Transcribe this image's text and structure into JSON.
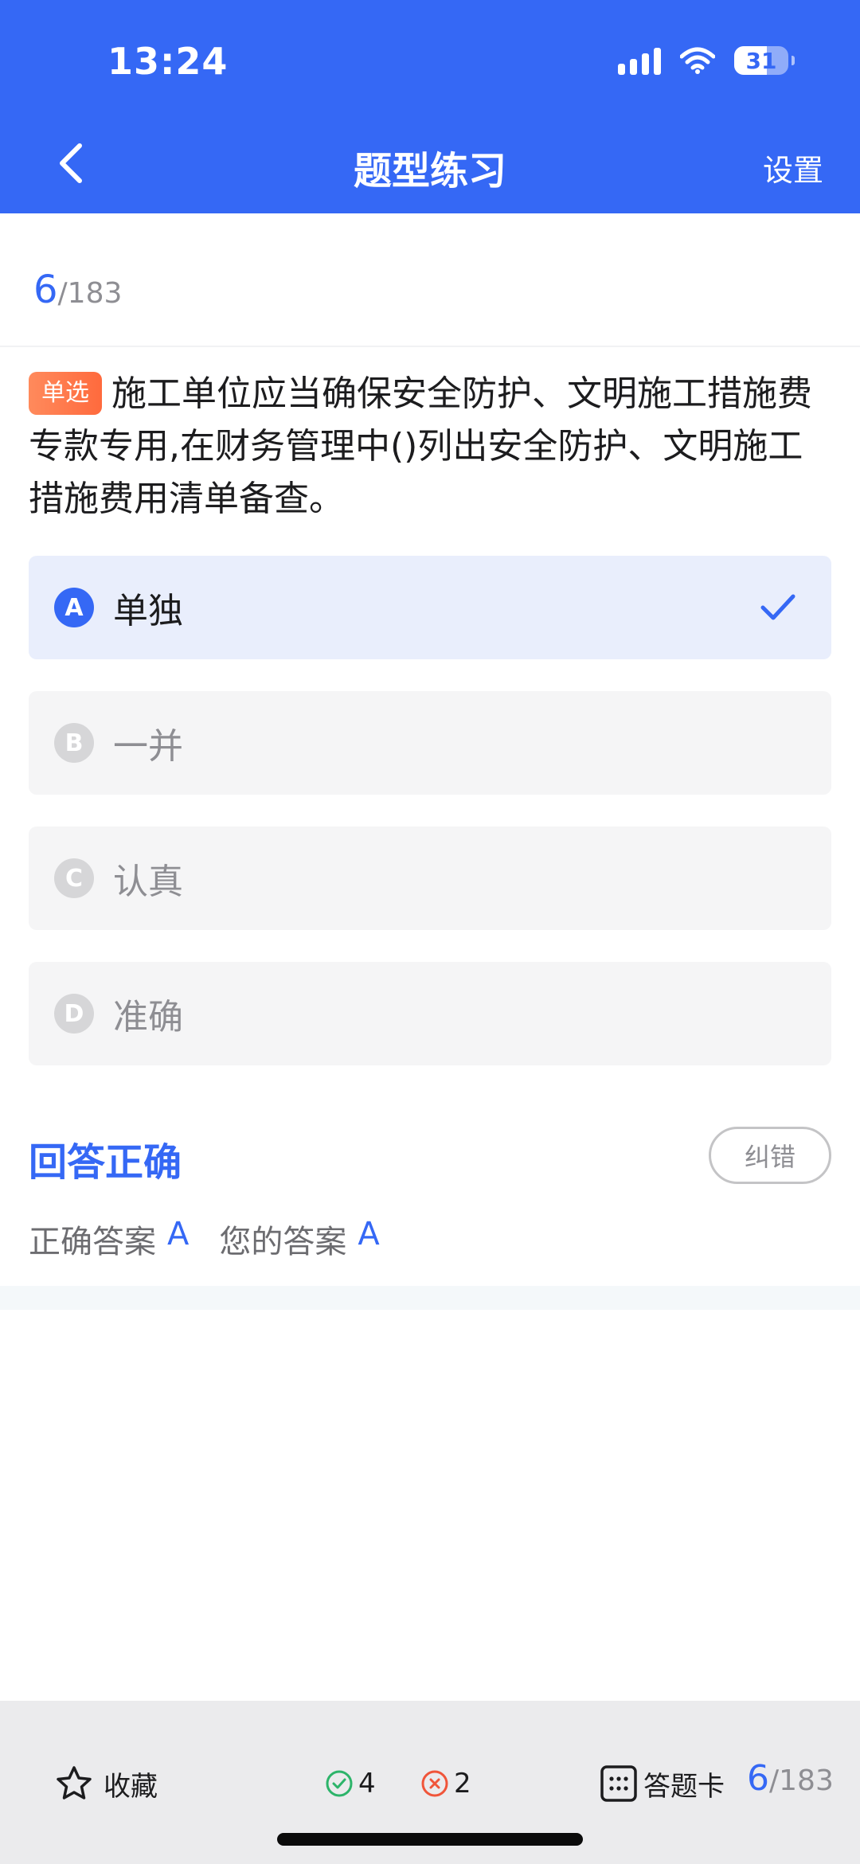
{
  "status_bar": {
    "time": "13:24",
    "battery": "31"
  },
  "nav": {
    "title": "题型练习",
    "settings": "设置"
  },
  "progress": {
    "current": "6",
    "total": "/183"
  },
  "question": {
    "tag": "单选",
    "text": "施工单位应当确保安全防护、文明施工措施费专款专用,在财务管理中()列出安全防护、文明施工措施费用清单备查。"
  },
  "options": [
    {
      "letter": "A",
      "text": "单独",
      "selected": true
    },
    {
      "letter": "B",
      "text": "一并"
    },
    {
      "letter": "C",
      "text": "认真"
    },
    {
      "letter": "D",
      "text": "准确"
    }
  ],
  "result": {
    "title": "回答正确",
    "report_button": "纠错",
    "correct_label": "正确答案",
    "correct_value": "A",
    "yours_label": "您的答案",
    "yours_value": "A"
  },
  "bottom_bar": {
    "favorite": "收藏",
    "correct_count": "4",
    "wrong_count": "2",
    "answer_card": "答题卡",
    "current": "6",
    "total": "/183"
  },
  "colors": {
    "accent": "#3568f5",
    "correct": "#2db46a",
    "wrong": "#f0553a",
    "tag": "#ff6a3d"
  }
}
